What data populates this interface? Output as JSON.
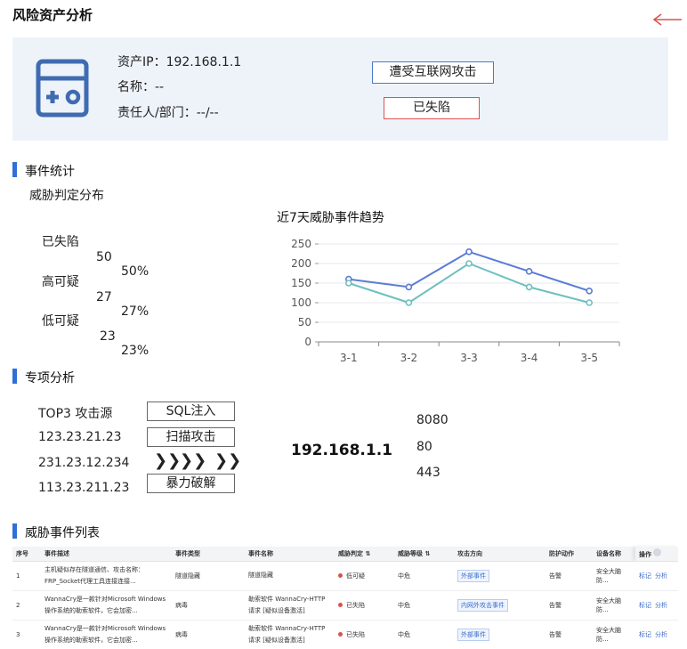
{
  "page": {
    "title": "风险资产分析"
  },
  "asset": {
    "ip_line": "资产IP：192.168.1.1",
    "name_line": "名称：--",
    "owner_line": "责任人/部门：--/--",
    "attack_tag": "遭受互联网攻击",
    "status_tag": "已失陷"
  },
  "event_stats": {
    "section_title": "事件统计",
    "dist_title": "威胁判定分布",
    "rows": [
      {
        "label": "已失陷",
        "count": "50",
        "percent": "50%"
      },
      {
        "label": "高可疑",
        "count": "27",
        "percent": "27%"
      },
      {
        "label": "低可疑",
        "count": "23",
        "percent": "23%"
      }
    ]
  },
  "chart_data": {
    "type": "line",
    "title": "近7天威胁事件趋势",
    "categories": [
      "3-1",
      "3-2",
      "3-3",
      "3-4",
      "3-5"
    ],
    "series": [
      {
        "values": [
          160,
          140,
          230,
          180,
          130
        ],
        "color": "#5b7bd5"
      },
      {
        "values": [
          150,
          100,
          200,
          140,
          100
        ],
        "color": "#6fbfbf"
      }
    ],
    "ylim": [
      0,
      250
    ],
    "yticks": [
      "0",
      "50",
      "100",
      "150",
      "200",
      "250"
    ],
    "grid": true,
    "xlabel": "",
    "ylabel": ""
  },
  "special": {
    "section_title": "专项分析",
    "sources_header": "TOP3 攻击源",
    "sources": [
      "123.23.21.23",
      "231.23.12.234",
      "113.23.211.23"
    ],
    "attack_types": [
      "SQL注入",
      "扫描攻击",
      "暴力破解"
    ],
    "chevron": "❯❯",
    "target_ip": "192.168.1.1",
    "ports": [
      "8080",
      "80",
      "443"
    ]
  },
  "events": {
    "section_title": "威胁事件列表",
    "columns": [
      "序号",
      "事件描述",
      "事件类型",
      "事件名称",
      "威胁判定",
      "威胁等级",
      "攻击方向",
      "防护动作",
      "设备名称",
      "操作"
    ],
    "rows": [
      {
        "no": "1",
        "desc": "主机疑似存在隧道通信、攻击名称：FRP_Socket代理工具连接连接...",
        "type": "隧道隐藏",
        "name": "隧道隐藏",
        "verdict": "低可疑",
        "level": "中危",
        "direction": "外部事件",
        "action": "告警",
        "device": "安全大脑防...",
        "op1": "标记",
        "op2": "分析"
      },
      {
        "no": "2",
        "desc": "WannaCry是一款针对Microsoft Windows操作系统的勒索软件，它会加密...",
        "type": "病毒",
        "name": "勒索软件 WannaCry-HTTP 请求 [疑似设备激活]",
        "verdict": "已失陷",
        "level": "中危",
        "direction": "内网外攻击事件",
        "action": "告警",
        "device": "安全大脑防...",
        "op1": "标记",
        "op2": "分析"
      },
      {
        "no": "3",
        "desc": "WannaCry是一款针对Microsoft Windows操作系统的勒索软件，它会加密...",
        "type": "病毒",
        "name": "勒索软件 WannaCry-HTTP 请求 [疑似设备激活]",
        "verdict": "已失陷",
        "level": "中危",
        "direction": "外部事件",
        "action": "告警",
        "device": "安全大脑防...",
        "op1": "标记",
        "op2": "分析"
      }
    ]
  }
}
